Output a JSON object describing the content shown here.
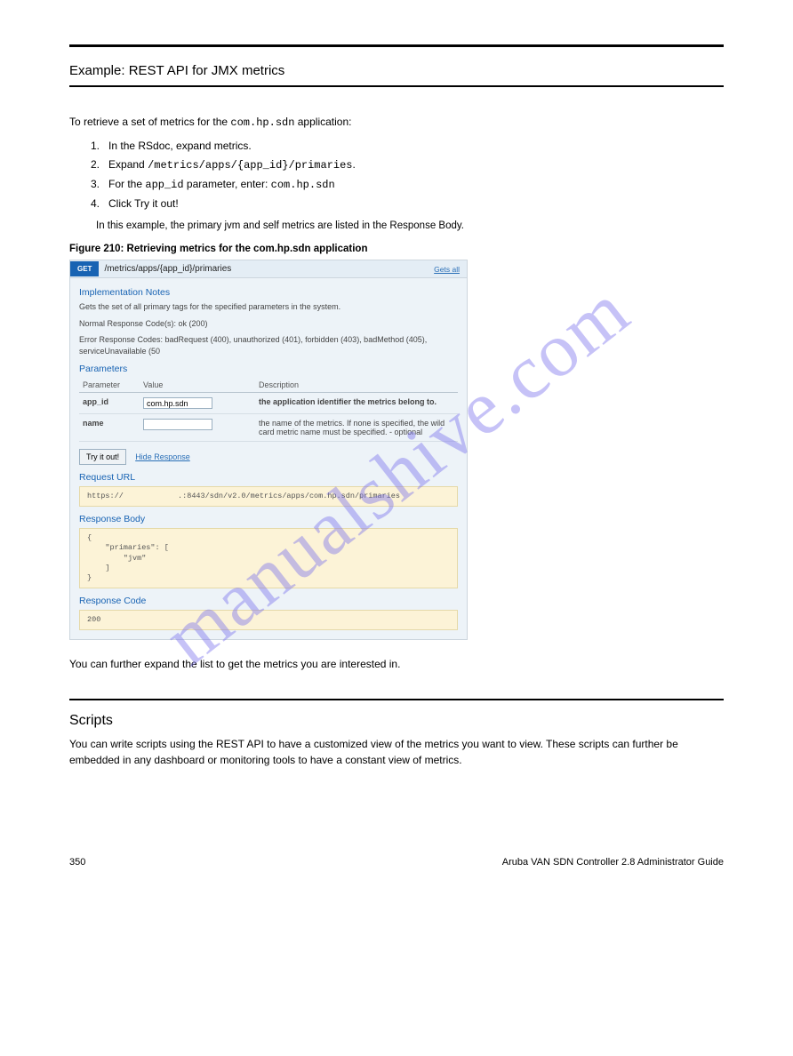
{
  "header": {
    "title": "Example: REST API for JMX metrics"
  },
  "intro": {
    "line1_prefix": "To retrieve a set of metrics for the ",
    "line1_code": "com.hp.sdn",
    "line1_suffix": " application:",
    "steps": [
      {
        "n": "1.",
        "t": "In the RSdoc, expand metrics."
      },
      {
        "n": "2.",
        "t_pre": "Expand ",
        "t_code": "/metrics/apps/{app_id}/primaries",
        "t_post": "."
      },
      {
        "n": "3.",
        "t_pre": "For the ",
        "t_code": "app_id",
        "t_post": " parameter, enter: ",
        "t_code2": "com.hp.sdn"
      },
      {
        "n": "4.",
        "t": "Click Try it out!"
      }
    ],
    "note": "In this example, the primary jvm and self metrics are listed in the Response Body.",
    "figureLabel": "Figure 210: Retrieving metrics for the com.hp.sdn application"
  },
  "api": {
    "method": "GET",
    "endpoint": "/metrics/apps/{app_id}/primaries",
    "getsAll": "Gets all",
    "implNotes": "Implementation Notes",
    "desc1": "Gets the set of all primary tags for the specified parameters in the system.",
    "desc2": "Normal Response Code(s): ok (200)",
    "desc3": "Error Response Codes: badRequest (400), unauthorized (401), forbidden (403), badMethod (405), serviceUnavailable (50",
    "paramsTitle": "Parameters",
    "paramHeaders": {
      "p": "Parameter",
      "v": "Value",
      "d": "Description"
    },
    "rows": [
      {
        "param": "app_id",
        "value": "com.hp.sdn",
        "desc": "the application identifier the metrics belong to.",
        "bold": true
      },
      {
        "param": "name",
        "value": "",
        "desc": "the name of the metrics. If none is specified, the wild card metric name must be specified. - optional",
        "bold": false
      }
    ],
    "tryLabel": "Try it out!",
    "hideResponse": "Hide Response",
    "requestUrlTitle": "Request URL",
    "requestUrl": "https://            .:8443/sdn/v2.0/metrics/apps/com.hp.sdn/primaries",
    "responseBodyTitle": "Response Body",
    "responseBody": "{\n    \"primaries\": [\n        \"jvm\"\n    ]\n}",
    "responseCodeTitle": "Response Code",
    "responseCode": "200"
  },
  "after": {
    "para": "You can further expand the list to get the metrics you are interested in.",
    "sectionTitle": "Scripts",
    "sectionBody": "You can write scripts using the REST API to have a customized view of the metrics you want to view. These scripts can further be embedded in any dashboard or monitoring tools to have a constant view of metrics."
  },
  "footer": {
    "left": "350",
    "right": "Aruba VAN SDN Controller 2.8 Administrator Guide"
  },
  "watermark": "manualshive.com"
}
